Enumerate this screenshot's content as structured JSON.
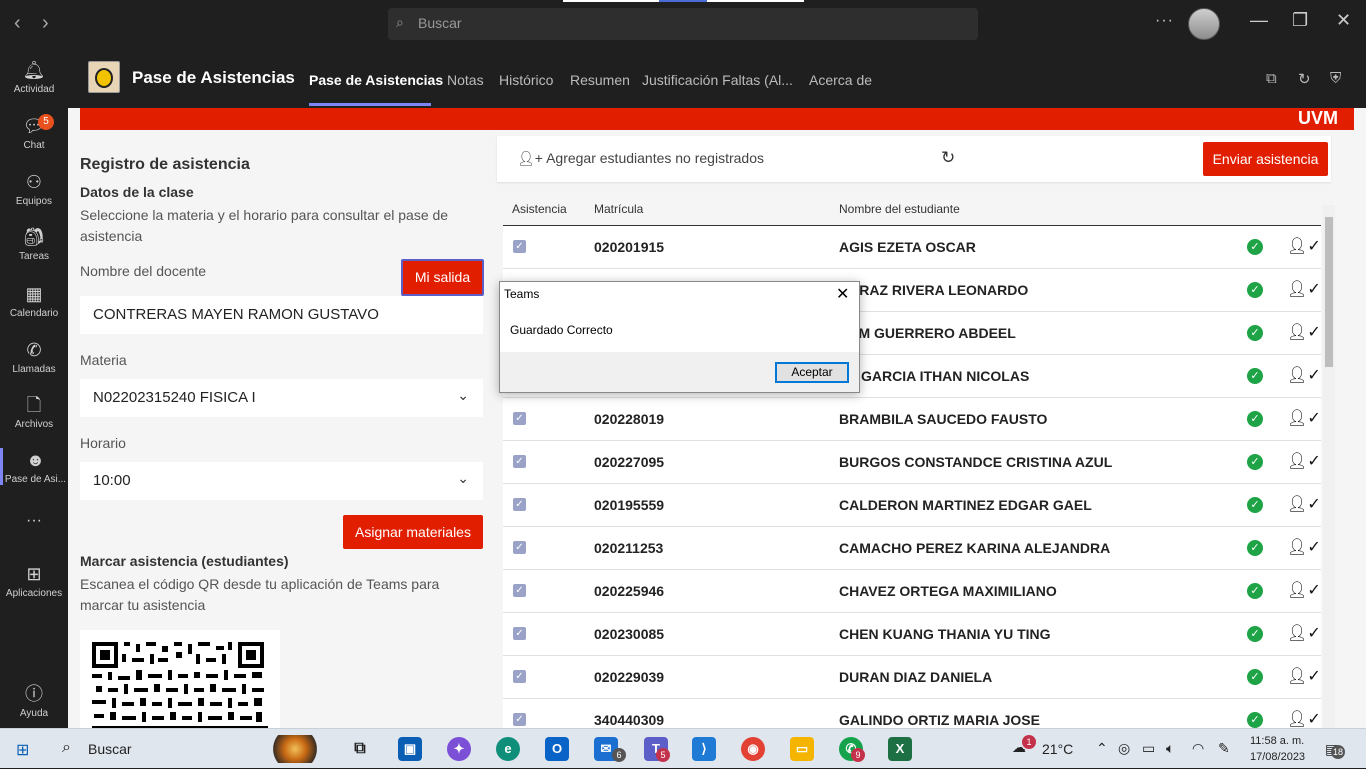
{
  "titlebar": {
    "search_placeholder": "Buscar",
    "more": "···",
    "minimize": "—",
    "restore": "❐",
    "close": "✕"
  },
  "rail": {
    "items": [
      {
        "label": "Actividad",
        "icon": "bell-icon"
      },
      {
        "label": "Chat",
        "icon": "chat-icon",
        "badge": "5"
      },
      {
        "label": "Equipos",
        "icon": "teams-icon"
      },
      {
        "label": "Tareas",
        "icon": "assignments-icon"
      },
      {
        "label": "Calendario",
        "icon": "calendar-icon"
      },
      {
        "label": "Llamadas",
        "icon": "phone-icon"
      },
      {
        "label": "Archivos",
        "icon": "file-icon"
      },
      {
        "label": "Pase de Asi...",
        "icon": "app-icon"
      },
      {
        "label": "Aplicaciones",
        "icon": "apps-icon"
      },
      {
        "label": "Ayuda",
        "icon": "help-icon"
      }
    ],
    "more": "···"
  },
  "app": {
    "title": "Pase de Asistencias",
    "tabs": [
      "Pase de Asistencias",
      "Notas",
      "Histórico",
      "Resumen",
      "Justificación Faltas (Al...",
      "Acerca de"
    ]
  },
  "banner": {
    "brand": "UVM"
  },
  "left": {
    "heading": "Registro de asistencia",
    "subheading": "Datos de la clase",
    "desc": "Seleccione la materia y el horario para consultar el pase de asistencia",
    "teacher_label": "Nombre del docente",
    "exit_button": "Mi salida",
    "teacher_value": "CONTRERAS MAYEN RAMON GUSTAVO",
    "subject_label": "Materia",
    "subject_value": "N02202315240 FISICA I",
    "schedule_label": "Horario",
    "schedule_value": "10:00",
    "assign_button": "Asignar materiales",
    "mark_heading": "Marcar asistencia (estudiantes)",
    "mark_desc": "Escanea el código QR desde tu aplicación de Teams para marcar tu asistencia"
  },
  "right": {
    "add_students": "Agregar estudiantes no registrados",
    "send_button": "Enviar asistencia",
    "columns": [
      "Asistencia",
      "Matrícula",
      "Nombre del estudiante"
    ],
    "rows": [
      {
        "matricula": "020201915",
        "nombre": "AGIS EZETA OSCAR"
      },
      {
        "matricula": "",
        "nombre": "CARAZ RIVERA LEONARDO"
      },
      {
        "matricula": "",
        "nombre": "SAM GUERRERO ABDEEL"
      },
      {
        "matricula": "",
        "nombre": "LA GARCIA ITHAN NICOLAS"
      },
      {
        "matricula": "020228019",
        "nombre": "BRAMBILA SAUCEDO FAUSTO"
      },
      {
        "matricula": "020227095",
        "nombre": "BURGOS CONSTANDCE CRISTINA AZUL"
      },
      {
        "matricula": "020195559",
        "nombre": "CALDERON MARTINEZ EDGAR GAEL"
      },
      {
        "matricula": "020211253",
        "nombre": "CAMACHO PEREZ KARINA ALEJANDRA"
      },
      {
        "matricula": "020225946",
        "nombre": "CHAVEZ ORTEGA MAXIMILIANO"
      },
      {
        "matricula": "020230085",
        "nombre": "CHEN KUANG THANIA YU TING"
      },
      {
        "matricula": "020229039",
        "nombre": "DURAN DIAZ DANIELA"
      },
      {
        "matricula": "340440309",
        "nombre": "GALINDO ORTIZ MARIA JOSE"
      }
    ]
  },
  "dialog": {
    "title": "Teams",
    "message": "Guardado Correcto",
    "ok": "Aceptar"
  },
  "taskbar": {
    "search": "Buscar",
    "mail_badge": "6",
    "teams_badge": "5",
    "whatsapp_badge": "9",
    "weather_badge": "1",
    "temperature": "21°C",
    "time": "11:58 a. m.",
    "date": "17/08/2023",
    "notifications": "18"
  },
  "colors": {
    "accent_red": "#e21e00",
    "teams_purple": "#7f85f5",
    "present_green": "#1ea446"
  }
}
